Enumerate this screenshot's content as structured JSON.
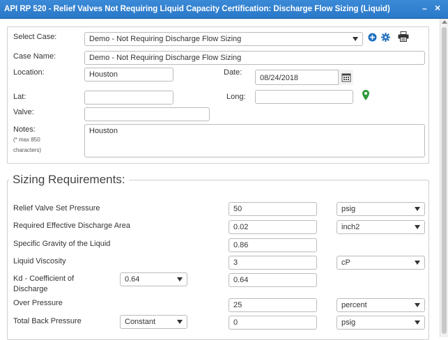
{
  "window": {
    "title": "API RP 520 - Relief Valves Not Requiring Liquid Capacity Certification: Discharge Flow Sizing (Liquid)",
    "minimize_glyph": "–",
    "close_glyph": "×"
  },
  "case": {
    "select_case_label": "Select Case:",
    "select_case_value": "Demo - Not Requiring Discharge Flow Sizing",
    "case_name_label": "Case Name:",
    "case_name_value": "Demo - Not Requiring Discharge Flow Sizing",
    "location_label": "Location:",
    "location_value": "Houston",
    "date_label": "Date:",
    "date_value": "08/24/2018",
    "lat_label": "Lat:",
    "lat_value": "",
    "long_label": "Long:",
    "long_value": "",
    "valve_label": "Valve:",
    "valve_value": "",
    "notes_label": "Notes:",
    "notes_hint_1": "(* max 850",
    "notes_hint_2": "characters)",
    "notes_value": "Houston"
  },
  "icons": {
    "add": "add-circle-icon",
    "settings": "gear-icon",
    "print": "printer-icon",
    "calendar": "calendar-icon",
    "location": "map-pin-icon"
  },
  "colors": {
    "titlebar": "#2a78c8",
    "add_icon": "#1f6fbf",
    "pin_icon": "#2e9a3a"
  },
  "sizing": {
    "legend": "Sizing Requirements:",
    "relief_valve_set_pressure": {
      "label": "Relief Valve Set Pressure",
      "value": "50",
      "unit": "psig"
    },
    "required_effective_discharge_area": {
      "label": "Required Effective Discharge Area",
      "value": "0.02",
      "unit": "inch2"
    },
    "specific_gravity": {
      "label": "Specific Gravity of the Liquid",
      "value": "0.86"
    },
    "liquid_viscosity": {
      "label": "Liquid Viscosity",
      "value": "3",
      "unit": "cP"
    },
    "kd": {
      "label_1": "Kd - Coefficient of",
      "label_2": "Discharge",
      "option": "0.64",
      "value": "0.64"
    },
    "over_pressure": {
      "label": "Over Pressure",
      "value": "25",
      "unit": "percent"
    },
    "total_back_pressure": {
      "label": "Total Back Pressure",
      "option": "Constant",
      "value": "0",
      "unit": "psig"
    }
  }
}
